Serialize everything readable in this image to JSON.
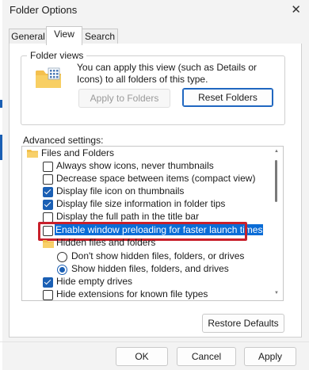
{
  "window": {
    "title": "Folder Options",
    "close_glyph": "✕"
  },
  "tabs": [
    {
      "label": "General",
      "active": false
    },
    {
      "label": "View",
      "active": true
    },
    {
      "label": "Search",
      "active": false
    }
  ],
  "folder_views": {
    "legend": "Folder views",
    "description": "You can apply this view (such as Details or Icons) to all folders of this type.",
    "apply_button": "Apply to Folders",
    "reset_button": "Reset Folders",
    "icon": "folder-grid-icon"
  },
  "advanced": {
    "label": "Advanced settings:",
    "items": [
      {
        "type": "folder",
        "label": "Files and Folders"
      },
      {
        "type": "checkbox",
        "label": "Always show icons, never thumbnails",
        "checked": false
      },
      {
        "type": "checkbox",
        "label": "Decrease space between items (compact view)",
        "checked": false
      },
      {
        "type": "checkbox",
        "label": "Display file icon on thumbnails",
        "checked": true
      },
      {
        "type": "checkbox",
        "label": "Display file size information in folder tips",
        "checked": true
      },
      {
        "type": "checkbox",
        "label": "Display the full path in the title bar",
        "checked": false
      },
      {
        "type": "checkbox",
        "label": "Enable window preloading for faster launch times",
        "checked": false,
        "selected": true
      },
      {
        "type": "folder",
        "label": "Hidden files and folders"
      },
      {
        "type": "radio",
        "label": "Don't show hidden files, folders, or drives",
        "checked": false
      },
      {
        "type": "radio",
        "label": "Show hidden files, folders, and drives",
        "checked": true
      },
      {
        "type": "checkbox",
        "label": "Hide empty drives",
        "checked": true
      },
      {
        "type": "checkbox",
        "label": "Hide extensions for known file types",
        "checked": false
      }
    ]
  },
  "buttons": {
    "restore_defaults": "Restore Defaults",
    "ok": "OK",
    "cancel": "Cancel",
    "apply": "Apply"
  },
  "colors": {
    "accent": "#1a5fb4",
    "highlight_border": "#c8202b",
    "selection_bg": "#0a6cd6"
  }
}
